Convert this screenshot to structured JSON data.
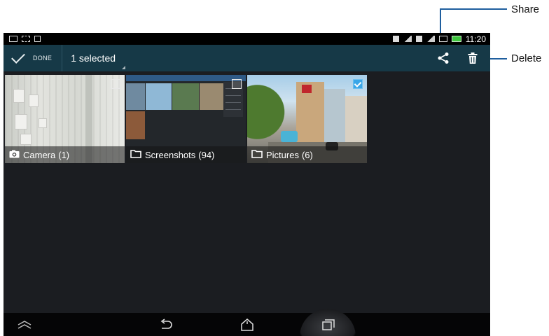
{
  "annotations": {
    "share_label": "Share",
    "delete_label": "Delete"
  },
  "status_bar": {
    "time": "11:20",
    "left_icons": [
      "screenshot-icon",
      "storage-icon",
      "sim-icon"
    ],
    "right_icons": [
      "sim1-icon",
      "signal-1-icon",
      "sim2-icon",
      "signal-2-icon",
      "media-icon",
      "battery-charging-icon"
    ]
  },
  "action_bar": {
    "done_label": "DONE",
    "selected_text": "1 selected",
    "share_icon": "share-icon",
    "delete_icon": "trash-icon"
  },
  "albums": [
    {
      "name": "Camera",
      "count": "(1)",
      "icon": "camera-icon",
      "selected": false
    },
    {
      "name": "Screenshots",
      "count": "(94)",
      "icon": "folder-icon",
      "selected": false
    },
    {
      "name": "Pictures",
      "count": "(6)",
      "icon": "folder-icon",
      "selected": true
    }
  ],
  "nav_bar": {
    "icons": [
      "home-launcher-icon",
      "back-icon",
      "home-icon",
      "recents-icon"
    ]
  },
  "colors": {
    "action_bar": "#163947",
    "background": "#1b1d21",
    "callout_line": "#1f5e9e",
    "check_selected": "#3aa6e8"
  }
}
